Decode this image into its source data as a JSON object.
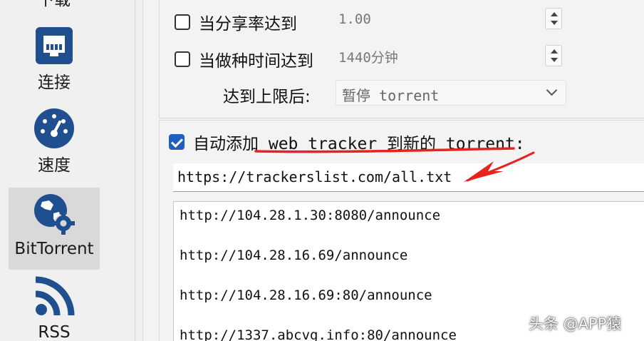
{
  "sidebar": {
    "items": [
      {
        "label": "下载",
        "icon": "download-icon"
      },
      {
        "label": "连接",
        "icon": "network-icon"
      },
      {
        "label": "速度",
        "icon": "speedometer-icon"
      },
      {
        "label": "BitTorrent",
        "icon": "globe-gear-icon",
        "active": true
      },
      {
        "label": "RSS",
        "icon": "rss-icon"
      }
    ]
  },
  "limits": {
    "ratio_label": "当分享率达到",
    "ratio_value": "1.00",
    "ratio_checked": false,
    "time_label": "当做种时间达到",
    "time_value": "1440分钟",
    "time_checked": false,
    "after_label": "达到上限后:",
    "after_value": "暂停 torrent"
  },
  "trackers": {
    "auto_add_label": "自动添加 web tracker 到新的 torrent:",
    "auto_add_checked": true,
    "url_value": "https://trackerslist.com/all.txt",
    "list": [
      "http://104.28.1.30:8080/announce",
      "http://104.28.16.69/announce",
      "http://104.28.16.69:80/announce",
      "http://1337.abcvg.info:80/announce"
    ]
  },
  "colors": {
    "accent": "#1f5fbf",
    "annotation_red": "#e8231f",
    "sidebar_icon": "#1f4f8f"
  },
  "watermark": "头条 @APP猿"
}
